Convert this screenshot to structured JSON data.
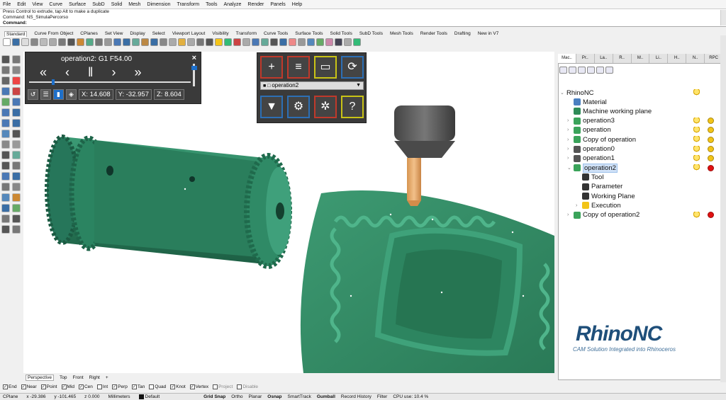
{
  "menu": [
    "File",
    "Edit",
    "View",
    "Curve",
    "Surface",
    "SubD",
    "Solid",
    "Mesh",
    "Dimension",
    "Transform",
    "Tools",
    "Analyze",
    "Render",
    "Panels",
    "Help"
  ],
  "command": {
    "line1": "Press Control to extrude, tap Alt to make a duplicate",
    "line2": "Command: NS_SimulaPercorso",
    "prompt": "Command:"
  },
  "toolbar_tabs": [
    "Standard",
    "Curve From Object",
    "CPlanes",
    "Set View",
    "Display",
    "Select",
    "Viewport Layout",
    "Visibility",
    "Transform",
    "Curve Tools",
    "Surface Tools",
    "Solid Tools",
    "SubD Tools",
    "Mesh Tools",
    "Render Tools",
    "Drafting",
    "New in V7"
  ],
  "player": {
    "title": "operation2: G1 F54.00",
    "close": "×",
    "controls": [
      "«",
      "‹",
      "‖",
      "›",
      "»"
    ],
    "x": "X: 14.608",
    "y": "Y: -32.957",
    "z": "Z: 8.604",
    "progress": 0.14
  },
  "ops_panel": {
    "selected": "operation2",
    "buttons_top": [
      {
        "glyph": "+",
        "border": "#c0392b"
      },
      {
        "glyph": "≡",
        "border": "#c0392b"
      },
      {
        "glyph": "▭",
        "border": "#c9c316"
      },
      {
        "glyph": "⟳",
        "border": "#2d6fb5"
      }
    ],
    "buttons_bottom": [
      {
        "glyph": "▼",
        "border": "#2d6fb5"
      },
      {
        "glyph": "⚙",
        "border": "#2d6fb5"
      },
      {
        "glyph": "✲",
        "border": "#c0392b"
      },
      {
        "glyph": "?",
        "border": "#c9c316"
      }
    ]
  },
  "viewport_tabs": [
    "Perspective",
    "Top",
    "Front",
    "Right",
    "+"
  ],
  "osnaps": [
    {
      "label": "End",
      "checked": true
    },
    {
      "label": "Near",
      "checked": true
    },
    {
      "label": "Point",
      "checked": true
    },
    {
      "label": "Mid",
      "checked": true
    },
    {
      "label": "Cen",
      "checked": true
    },
    {
      "label": "Int",
      "checked": false
    },
    {
      "label": "Perp",
      "checked": true
    },
    {
      "label": "Tan",
      "checked": true
    },
    {
      "label": "Quad",
      "checked": false
    },
    {
      "label": "Knot",
      "checked": true
    },
    {
      "label": "Vertex",
      "checked": true
    },
    {
      "label": "Project",
      "checked": false,
      "disabled": true
    },
    {
      "label": "Disable",
      "checked": false,
      "disabled": true
    }
  ],
  "status": {
    "cplane": "CPlane",
    "x": "x -29.386",
    "y": "y -101.465",
    "z": "z 0.000",
    "units": "Millimeters",
    "layer": "Default",
    "toggles": [
      {
        "label": "Grid Snap",
        "bold": true
      },
      {
        "label": "Ortho",
        "bold": false
      },
      {
        "label": "Planar",
        "bold": false
      },
      {
        "label": "Osnap",
        "bold": true
      },
      {
        "label": "SmartTrack",
        "bold": false
      },
      {
        "label": "Gumball",
        "bold": true
      },
      {
        "label": "Record History",
        "bold": false
      },
      {
        "label": "Filter",
        "bold": false
      },
      {
        "label": "CPU use: 10.4 %",
        "bold": false
      }
    ]
  },
  "right_tabs": [
    "Mac..",
    "Pr..",
    "La..",
    "R..",
    "M..",
    "Li..",
    "H..",
    "N..",
    "RPC"
  ],
  "tree": {
    "root": "RhinoNC",
    "items": [
      {
        "label": "Material",
        "indent": 1,
        "chev": "",
        "icon": "#4a7fc0"
      },
      {
        "label": "Machine working plane",
        "indent": 1,
        "chev": "",
        "icon": "#2e8b57"
      },
      {
        "label": "operation3",
        "indent": 1,
        "chev": "›",
        "icon": "#3aa35a",
        "bulb": true,
        "dot": "#f2c418"
      },
      {
        "label": "operation",
        "indent": 1,
        "chev": "›",
        "icon": "#3aa35a",
        "bulb": true,
        "dot": "#f2c418"
      },
      {
        "label": "Copy of operation",
        "indent": 1,
        "chev": "›",
        "icon": "#3aa35a",
        "bulb": true,
        "dot": "#f2c418"
      },
      {
        "label": "operation0",
        "indent": 1,
        "chev": "›",
        "icon": "#555555",
        "bulb": true,
        "dot": "#f2c418"
      },
      {
        "label": "operation1",
        "indent": 1,
        "chev": "›",
        "icon": "#555555",
        "bulb": true,
        "dot": "#f2c418"
      },
      {
        "label": "operation2",
        "indent": 1,
        "chev": "⌄",
        "icon": "#3aa35a",
        "bulb": true,
        "dot": "#e01010",
        "selected": true
      },
      {
        "label": "Tool",
        "indent": 2,
        "chev": "",
        "icon": "#333333"
      },
      {
        "label": "Parameter",
        "indent": 2,
        "chev": "",
        "icon": "#333333"
      },
      {
        "label": "Working Plane",
        "indent": 2,
        "chev": "",
        "icon": "#333333"
      },
      {
        "label": "Execution",
        "indent": 2,
        "chev": "›",
        "icon": "#f2c418"
      },
      {
        "label": "Copy of operation2",
        "indent": 1,
        "chev": "›",
        "icon": "#3aa35a",
        "bulb": true,
        "dot": "#e01010"
      }
    ]
  },
  "logo": {
    "main": "RhinoNC",
    "tagline": "CAM Solution Integrated into Rhinoceros"
  },
  "colors": {
    "part_green": "#2f8a66",
    "part_green_dark": "#1f6a4c",
    "part_green_light": "#43a07b",
    "tool_gray": "#555",
    "tool_tip": "#e2a35e",
    "accent_blue": "#1e6fc9"
  }
}
